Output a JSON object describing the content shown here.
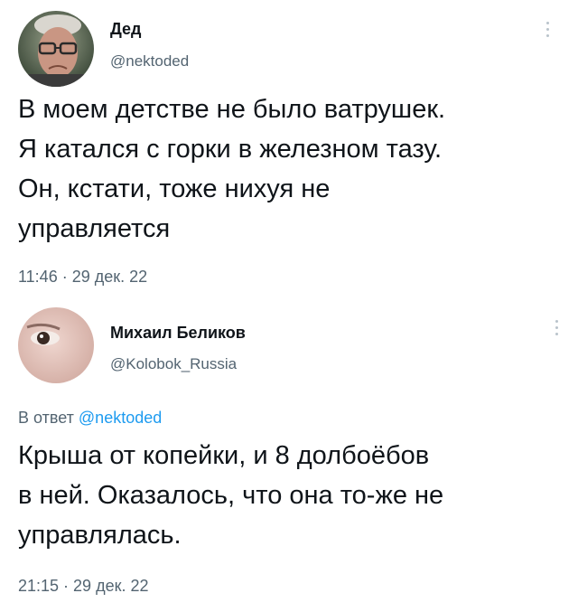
{
  "tweets": [
    {
      "author_name": "Дед",
      "author_handle": "@nektoded",
      "text": "В моем детстве не было ватрушек.\nЯ катался с горки в железном тазу.\nОн, кстати, тоже нихуя не\nуправляется",
      "timestamp": "11:46 · 29 дек. 22",
      "more_icon": "more-vertical-icon"
    },
    {
      "author_name": "Михаил Беликов",
      "author_handle": "@Kolobok_Russia",
      "reply_prefix": "В ответ",
      "reply_mention": "@nektoded",
      "text": "Крыша от копейки, и 8 долбоёбов\nв ней. Оказалось, что она то-же не\nуправлялась.",
      "timestamp": "21:15 · 29 дек. 22",
      "more_icon": "more-vertical-icon"
    }
  ],
  "colors": {
    "text": "#0f1419",
    "secondary": "#536471",
    "mention": "#1d9bf0"
  }
}
